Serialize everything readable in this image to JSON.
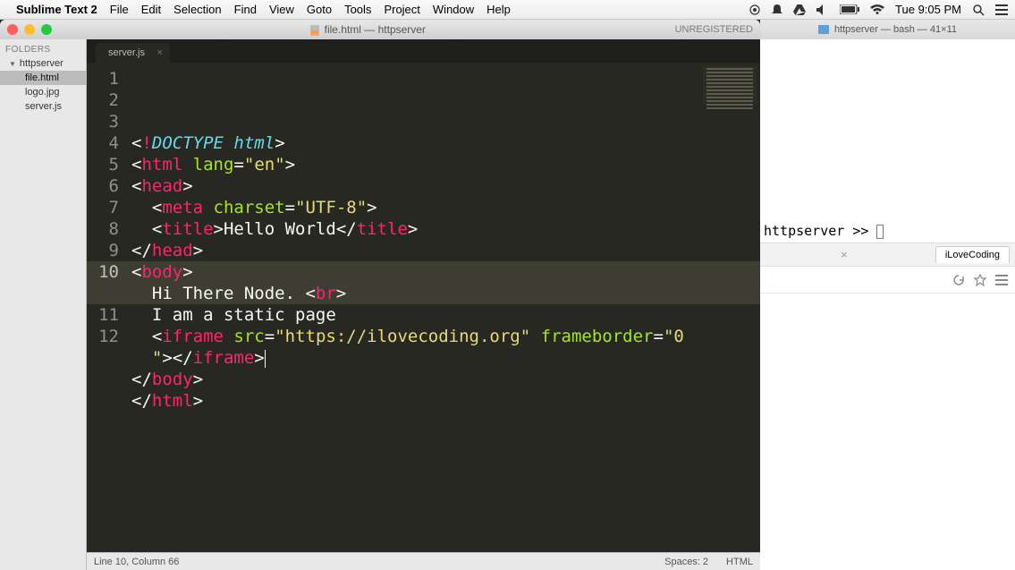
{
  "menubar": {
    "app_name": "Sublime Text 2",
    "items": [
      "File",
      "Edit",
      "Selection",
      "Find",
      "View",
      "Goto",
      "Tools",
      "Project",
      "Window",
      "Help"
    ],
    "clock": "Tue 9:05 PM"
  },
  "sublime": {
    "title": "file.html — httpserver",
    "unregistered": "UNREGISTERED",
    "sidebar": {
      "heading": "FOLDERS",
      "folder": "httpserver",
      "files": [
        "file.html",
        "logo.jpg",
        "server.js"
      ],
      "active_index": 0
    },
    "tab": {
      "label": "server.js"
    },
    "code": {
      "line_numbers": [
        "1",
        "2",
        "3",
        "4",
        "5",
        "6",
        "7",
        "8",
        "9",
        "10",
        "",
        "11",
        "12"
      ],
      "lines_tokens": [
        [
          [
            "p",
            "<"
          ],
          [
            "t",
            "!"
          ],
          [
            "d",
            "DOCTYPE html"
          ],
          [
            "p",
            ">"
          ]
        ],
        [
          [
            "p",
            "<"
          ],
          [
            "t",
            "html"
          ],
          [
            "p",
            " "
          ],
          [
            "a",
            "lang"
          ],
          [
            "p",
            "="
          ],
          [
            "s",
            "\"en\""
          ],
          [
            "p",
            ">"
          ]
        ],
        [
          [
            "p",
            "<"
          ],
          [
            "t",
            "head"
          ],
          [
            "p",
            ">"
          ]
        ],
        [
          [
            "p",
            "  <"
          ],
          [
            "t",
            "meta"
          ],
          [
            "p",
            " "
          ],
          [
            "a",
            "charset"
          ],
          [
            "p",
            "="
          ],
          [
            "s",
            "\"UTF-8\""
          ],
          [
            "p",
            ">"
          ]
        ],
        [
          [
            "p",
            "  <"
          ],
          [
            "t",
            "title"
          ],
          [
            "p",
            ">"
          ],
          [
            "p",
            "Hello World"
          ],
          [
            "p",
            "</"
          ],
          [
            "t",
            "title"
          ],
          [
            "p",
            ">"
          ]
        ],
        [
          [
            "p",
            "</"
          ],
          [
            "t",
            "head"
          ],
          [
            "p",
            ">"
          ]
        ],
        [
          [
            "p",
            "<"
          ],
          [
            "t",
            "body"
          ],
          [
            "p",
            ">"
          ]
        ],
        [
          [
            "p",
            "  Hi There Node. <"
          ],
          [
            "t",
            "br"
          ],
          [
            "p",
            ">"
          ]
        ],
        [
          [
            "p",
            "  I am a static page"
          ]
        ],
        [
          [
            "p",
            "  <"
          ],
          [
            "t",
            "iframe"
          ],
          [
            "p",
            " "
          ],
          [
            "a",
            "src"
          ],
          [
            "p",
            "="
          ],
          [
            "s",
            "\"https://ilovecoding.org\""
          ],
          [
            "p",
            " "
          ],
          [
            "a",
            "frameborder"
          ],
          [
            "p",
            "="
          ],
          [
            "s",
            "\"0"
          ]
        ],
        [
          [
            "s",
            "  \""
          ],
          [
            "p",
            "></"
          ],
          [
            "t",
            "iframe"
          ],
          [
            "p",
            ">"
          ]
        ],
        [
          [
            "p",
            "</"
          ],
          [
            "t",
            "body"
          ],
          [
            "p",
            ">"
          ]
        ],
        [
          [
            "p",
            "</"
          ],
          [
            "t",
            "html"
          ],
          [
            "p",
            ">"
          ]
        ]
      ],
      "highlighted_line_index": 9
    },
    "statusbar": {
      "left": "Line 10, Column 66",
      "spaces": "Spaces: 2",
      "syntax": "HTML"
    }
  },
  "terminal": {
    "title": "httpserver — bash — 41×11",
    "prompt": "httpserver >> "
  },
  "browser": {
    "tab_label": "iLoveCoding"
  }
}
